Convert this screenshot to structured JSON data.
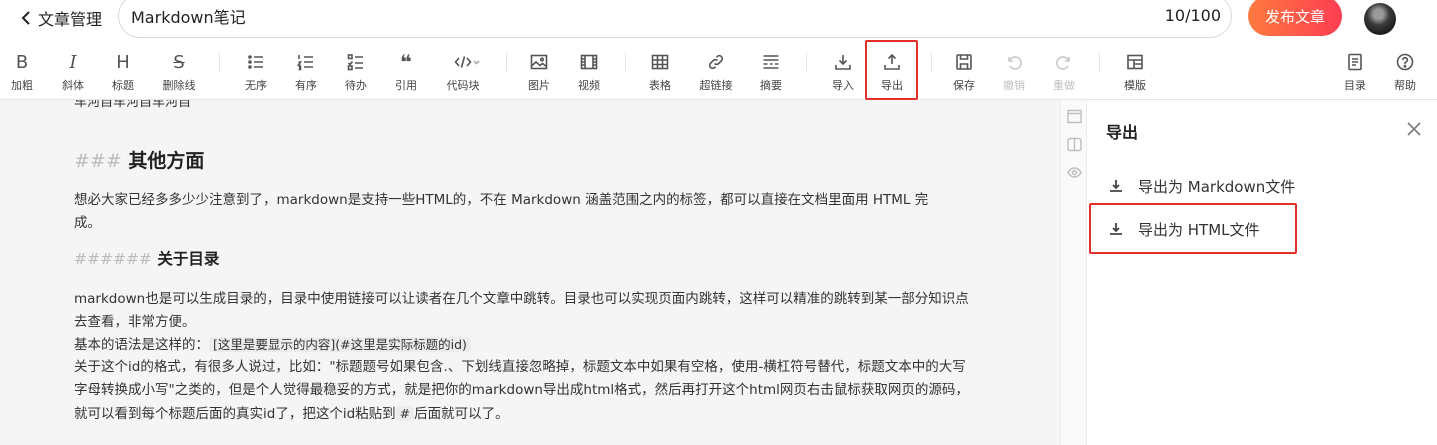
{
  "header": {
    "back_label": "文章管理",
    "title_value": "Markdown笔记",
    "title_count": "10/100",
    "publish_label": "发布文章"
  },
  "toolbar": {
    "bold": "加粗",
    "italic": "斜体",
    "heading": "标题",
    "strike": "删除线",
    "unordered": "无序",
    "ordered": "有序",
    "todo": "待办",
    "quote": "引用",
    "codeblock": "代码块",
    "image": "图片",
    "video": "视频",
    "table": "表格",
    "link": "超链接",
    "summary": "摘要",
    "import": "导入",
    "export": "导出",
    "save": "保存",
    "undo": "撤销",
    "redo": "重做",
    "template": "模版",
    "toc": "目录",
    "help": "帮助",
    "glyph_bold": "B",
    "glyph_italic": "I",
    "glyph_heading": "H",
    "glyph_strike": "S",
    "glyph_quote": "❝"
  },
  "editor": {
    "cut_line": "车河自车河自车河自",
    "h3_mark": "###",
    "h3_text": "其他方面",
    "p1": "想必大家已经多多少少注意到了，markdown是支持一些HTML的，不在 Markdown 涵盖范围之内的标签，都可以直接在文档里面用 HTML 完成。",
    "h6_mark": "######",
    "h6_text": "关于目录",
    "p2": "markdown也是可以生成目录的，目录中使用链接可以让读者在几个文章中跳转。目录也可以实现页面内跳转，这样可以精准的跳转到某一部分知识点去查看，非常方便。",
    "p3_prefix": "基本的语法是这样的：",
    "p3_code": "[这里是要显示的内容](#这里是实际标题的id)",
    "p4_a": "关于这个id的格式，有很多人说过，比如：\"标题题号如果包含.、下划线直接忽略掉，标题文本中如果有空格，使用-横杠符号替代，标题文本中的大写字母转换成小写\"之类的，但是个人觉得最稳妥的方式，就是把你的markdown导出成html格式，然后再打开这个html网页右击鼠标获取网页的源码，就可以看到每个标题后面的真实id了，把这个id粘贴到",
    "p4_code": "#",
    "p4_b": "后面就可以了。"
  },
  "export_panel": {
    "title": "导出",
    "option_markdown": "导出为 Markdown文件",
    "option_html": "导出为 HTML文件"
  },
  "colors": {
    "accent_red": "#e3302b",
    "publish_gradient_start": "#fd7a3e",
    "publish_gradient_end": "#fc3d52"
  }
}
